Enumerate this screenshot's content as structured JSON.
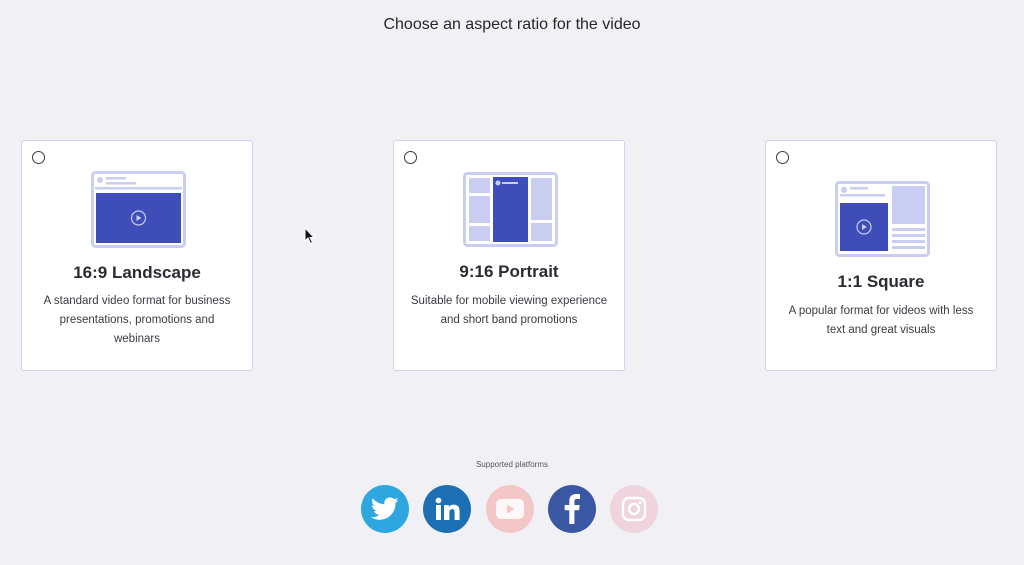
{
  "header": {
    "title": "Choose an aspect ratio for the video"
  },
  "options": [
    {
      "title": "16:9 Landscape",
      "description": "A standard video format for business presentations, promotions and webinars",
      "selected": false
    },
    {
      "title": "9:16 Portrait",
      "description": "Suitable for mobile viewing experience and short band promotions",
      "selected": false
    },
    {
      "title": "1:1 Square",
      "description": "A popular format for videos with less text and great visuals",
      "selected": false
    }
  ],
  "platforms": {
    "label": "Supported platforms",
    "items": [
      {
        "name": "twitter",
        "icon": "twitter-icon",
        "color": "#2ea7e0",
        "enabled": true
      },
      {
        "name": "linkedin",
        "icon": "linkedin-icon",
        "color": "#1d6fb3",
        "enabled": true
      },
      {
        "name": "youtube",
        "icon": "youtube-icon",
        "color": "#f3c7c7",
        "enabled": false
      },
      {
        "name": "facebook",
        "icon": "facebook-icon",
        "color": "#3a57a4",
        "enabled": true
      },
      {
        "name": "instagram",
        "icon": "instagram-icon",
        "color": "#efd4dd",
        "enabled": false
      }
    ]
  },
  "colors": {
    "accent": "#3f4db8",
    "illustration_light": "#c9cdf2",
    "card_border": "#cfd2ec",
    "background": "#f1f1f5"
  }
}
